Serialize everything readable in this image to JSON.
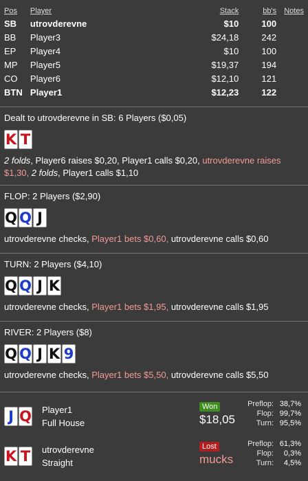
{
  "header": {
    "pos": "Pos",
    "player": "Player",
    "stack": "Stack",
    "bbs": "bb's",
    "notes": "Notes"
  },
  "seats": [
    {
      "pos": "SB",
      "name": "utrovderevne",
      "stack": "$10",
      "bb": "100",
      "bold": true
    },
    {
      "pos": "BB",
      "name": "Player3",
      "stack": "$24,18",
      "bb": "242",
      "bold": false
    },
    {
      "pos": "EP",
      "name": "Player4",
      "stack": "$10",
      "bb": "100",
      "bold": false
    },
    {
      "pos": "MP",
      "name": "Player5",
      "stack": "$19,37",
      "bb": "194",
      "bold": false
    },
    {
      "pos": "CO",
      "name": "Player6",
      "stack": "$12,10",
      "bb": "121",
      "bold": false
    },
    {
      "pos": "BTN",
      "name": "Player1",
      "stack": "$12,23",
      "bb": "122",
      "bold": true
    }
  ],
  "preflop": {
    "title": "Dealt to utrovderevne in SB: 6 Players ($0,05)",
    "cards": [
      {
        "rank": "K",
        "color": "red"
      },
      {
        "rank": "T",
        "color": "red"
      }
    ],
    "a1": "2 folds",
    "a2": ", Player6 raises $0,20, Player1 calls $0,20, ",
    "a3": "utrovderevne raises $1,30,",
    "a4": " ",
    "a5": "2 folds",
    "a6": ", Player1 calls $1,10"
  },
  "flop": {
    "title": "FLOP: 2 Players ($2,90)",
    "cards": [
      {
        "rank": "Q",
        "color": "black"
      },
      {
        "rank": "Q",
        "color": "blue"
      },
      {
        "rank": "J",
        "color": "black"
      }
    ],
    "a1": "utrovderevne checks, ",
    "a2": "Player1 bets $0,60,",
    "a3": " utrovderevne calls $0,60"
  },
  "turn": {
    "title": "TURN: 2 Players ($4,10)",
    "cards": [
      {
        "rank": "Q",
        "color": "black"
      },
      {
        "rank": "Q",
        "color": "blue"
      },
      {
        "rank": "J",
        "color": "black"
      },
      {
        "rank": "K",
        "color": "black"
      }
    ],
    "a1": "utrovderevne checks, ",
    "a2": "Player1 bets $1,95,",
    "a3": " utrovderevne calls $1,95"
  },
  "river": {
    "title": "RIVER: 2 Players ($8)",
    "cards": [
      {
        "rank": "Q",
        "color": "black"
      },
      {
        "rank": "Q",
        "color": "blue"
      },
      {
        "rank": "J",
        "color": "black"
      },
      {
        "rank": "K",
        "color": "black"
      },
      {
        "rank": "9",
        "color": "blue"
      }
    ],
    "a1": "utrovderevne checks, ",
    "a2": "Player1 bets $5,50,",
    "a3": " utrovderevne calls $5,50"
  },
  "showdown": [
    {
      "name": "Player1",
      "hand": "Full House",
      "cards": [
        {
          "rank": "J",
          "color": "blue"
        },
        {
          "rank": "Q",
          "color": "red"
        }
      ],
      "result": "Won",
      "amount": "$18,05",
      "stats": [
        {
          "label": "Preflop:",
          "value": "38,7%"
        },
        {
          "label": "Flop:",
          "value": "99,7%"
        },
        {
          "label": "Turn:",
          "value": "95,5%"
        }
      ]
    },
    {
      "name": "utrovderevne",
      "hand": "Straight",
      "cards": [
        {
          "rank": "K",
          "color": "red"
        },
        {
          "rank": "T",
          "color": "red"
        }
      ],
      "result": "Lost",
      "amount": "mucks",
      "stats": [
        {
          "label": "Preflop:",
          "value": "61,3%"
        },
        {
          "label": "Flop:",
          "value": "0,3%"
        },
        {
          "label": "Turn:",
          "value": "4,5%"
        }
      ]
    }
  ],
  "colors": {
    "background": "#3b3b3b",
    "highlight": "#f29b96",
    "won": "#3e8e1f",
    "lost": "#b51e1e"
  }
}
